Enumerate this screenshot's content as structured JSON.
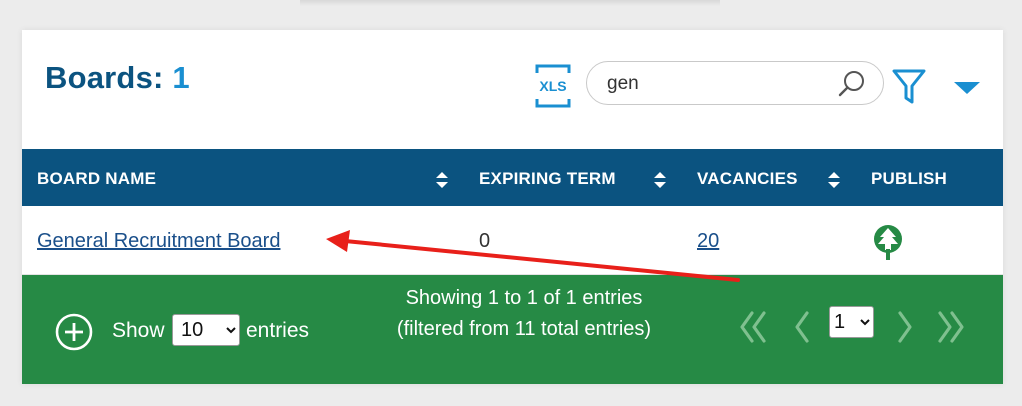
{
  "header": {
    "title": "Boards:",
    "count": "1",
    "xls_label": "XLS"
  },
  "search": {
    "value": "gen",
    "placeholder": ""
  },
  "table": {
    "columns": [
      "BOARD NAME",
      "EXPIRING TERM",
      "VACANCIES",
      "PUBLISH"
    ],
    "rows": [
      {
        "board_name": "General Recruitment Board",
        "expiring_term": "0",
        "vacancies": "20",
        "publish_icon": "tree-icon"
      }
    ]
  },
  "footer": {
    "show_label": "Show",
    "entries_value": "10",
    "entries_label": "entries",
    "info": "Showing 1 to 1 of 1 entries (filtered from 11 total entries)",
    "page_value": "1"
  },
  "colors": {
    "header_bg": "#0b5380",
    "accent": "#1a8fd1",
    "footer_bg": "#268a45",
    "annotation_arrow": "#e8201a"
  }
}
